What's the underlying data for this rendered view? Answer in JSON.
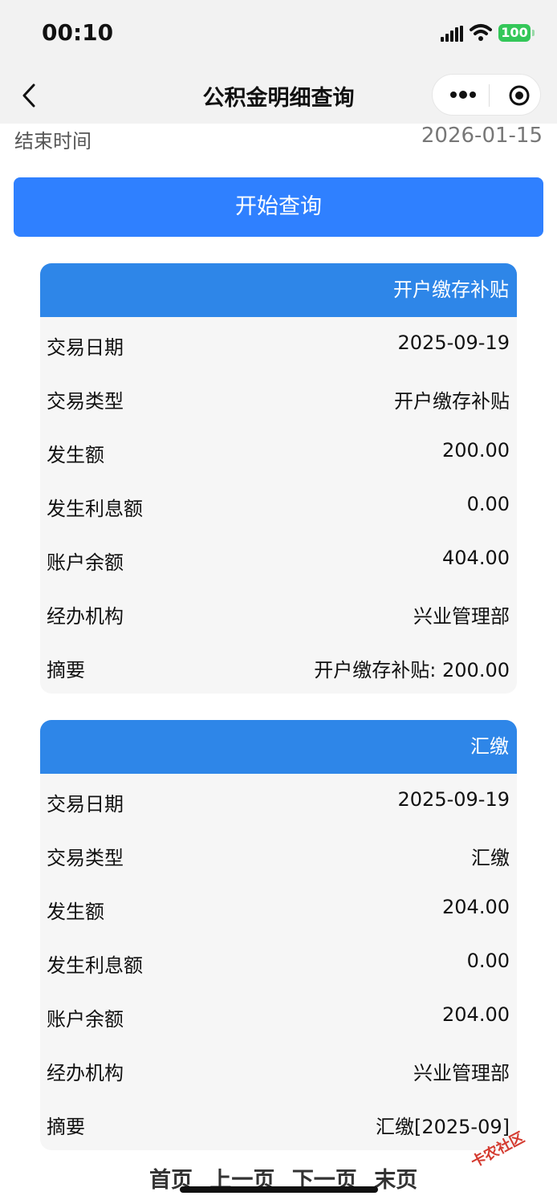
{
  "status": {
    "time": "00:10",
    "battery": "100"
  },
  "nav": {
    "title": "公积金明细查询"
  },
  "filter": {
    "end_label": "结束时间",
    "end_value": "2026-01-15",
    "query_button": "开始查询"
  },
  "records": [
    {
      "header": "开户缴存补贴",
      "fields": [
        {
          "label": "交易日期",
          "value": "2025-09-19"
        },
        {
          "label": "交易类型",
          "value": "开户缴存补贴"
        },
        {
          "label": "发生额",
          "value": "200.00"
        },
        {
          "label": "发生利息额",
          "value": "0.00"
        },
        {
          "label": "账户余额",
          "value": "404.00"
        },
        {
          "label": "经办机构",
          "value": "兴业管理部"
        },
        {
          "label": "摘要",
          "value": "开户缴存补贴: 200.00"
        }
      ]
    },
    {
      "header": "汇缴",
      "fields": [
        {
          "label": "交易日期",
          "value": "2025-09-19"
        },
        {
          "label": "交易类型",
          "value": "汇缴"
        },
        {
          "label": "发生额",
          "value": "204.00"
        },
        {
          "label": "发生利息额",
          "value": "0.00"
        },
        {
          "label": "账户余额",
          "value": "204.00"
        },
        {
          "label": "经办机构",
          "value": "兴业管理部"
        },
        {
          "label": "摘要",
          "value": "汇缴[2025-09]"
        }
      ]
    }
  ],
  "pager": {
    "first": "首页",
    "prev": "上一页",
    "next": "下一页",
    "last": "末页"
  },
  "watermark": {
    "text": "卡农社区"
  },
  "colors": {
    "primary": "#2f80ff",
    "card_header": "#2e86e8",
    "battery": "#34c759"
  }
}
